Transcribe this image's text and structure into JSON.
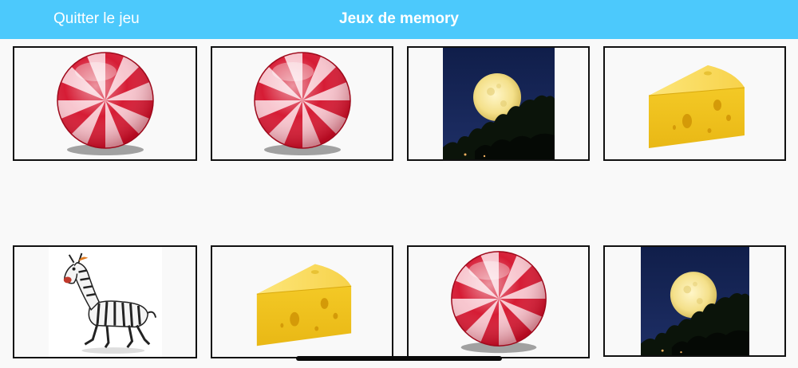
{
  "navbar": {
    "quit_label": "Quitter le jeu",
    "title": "Jeux de memory",
    "color": "#4cc9fc"
  },
  "cards": [
    {
      "image": "candy-icon"
    },
    {
      "image": "candy-icon"
    },
    {
      "image": "moon-icon"
    },
    {
      "image": "cheese-icon"
    },
    {
      "image": "zebra-icon"
    },
    {
      "image": "cheese-icon"
    },
    {
      "image": "candy-icon"
    },
    {
      "image": "moon-icon"
    }
  ]
}
